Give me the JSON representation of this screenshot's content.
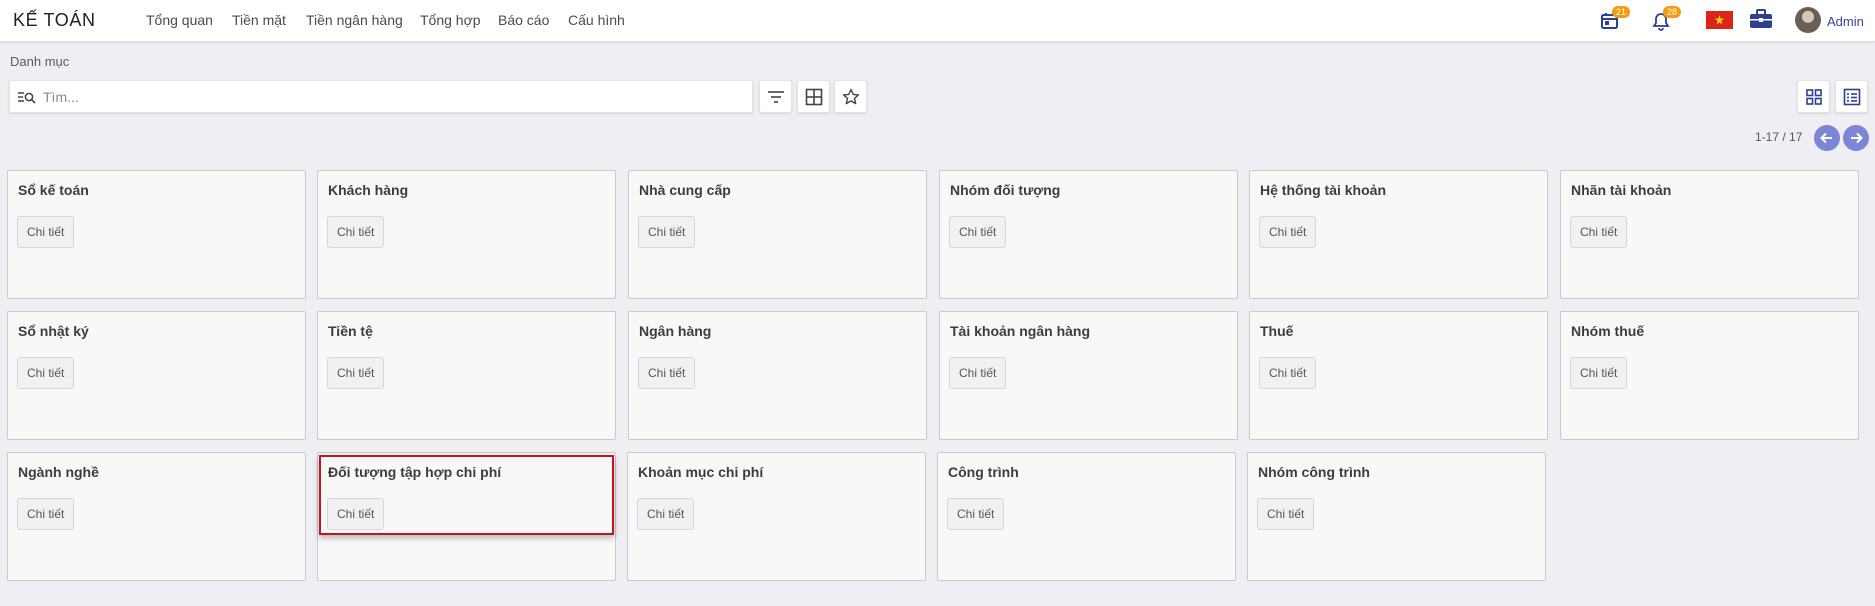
{
  "app": {
    "title": "KẾ TOÁN"
  },
  "menu": [
    {
      "label": "Tổng quan"
    },
    {
      "label": "Tiền mặt"
    },
    {
      "label": "Tiền ngân hàng"
    },
    {
      "label": "Tổng hợp"
    },
    {
      "label": "Báo cáo"
    },
    {
      "label": "Cấu hình"
    }
  ],
  "header": {
    "calendar_badge": "21",
    "notification_badge": "28",
    "user_name": "Admin"
  },
  "breadcrumb": "Danh mục",
  "search": {
    "placeholder": "Tìm..."
  },
  "pager": {
    "text": "1-17 / 17"
  },
  "card_button_label": "Chi tiết",
  "cards": [
    {
      "title": "Sổ kế toán",
      "button": "Chi tiết"
    },
    {
      "title": "Khách hàng",
      "button": "Chi tiết"
    },
    {
      "title": "Nhà cung cấp",
      "button": "Chi tiết"
    },
    {
      "title": "Nhóm đối tượng",
      "button": "Chi tiết"
    },
    {
      "title": "Hệ thống tài khoản",
      "button": "Chi tiết"
    },
    {
      "title": "Nhãn tài khoản",
      "button": "Chi tiết"
    },
    {
      "title": "Sổ nhật ký",
      "button": "Chi tiết"
    },
    {
      "title": "Tiền tệ",
      "button": "Chi tiết"
    },
    {
      "title": "Ngân hàng",
      "button": "Chi tiết"
    },
    {
      "title": "Tài khoản ngân hàng",
      "button": "Chi tiết"
    },
    {
      "title": "Thuế",
      "button": "Chi tiết"
    },
    {
      "title": "Nhóm thuế",
      "button": "Chi tiết"
    },
    {
      "title": "Ngành nghề",
      "button": "Chi tiết"
    },
    {
      "title": "Đối tượng tập hợp chi phí",
      "button": "Chi tiết"
    },
    {
      "title": "Khoản mục chi phí",
      "button": "Chi tiết"
    },
    {
      "title": "Công trình",
      "button": "Chi tiết"
    },
    {
      "title": "Nhóm công trình",
      "button": "Chi tiết"
    }
  ],
  "colors": {
    "accent": "#7c86d6",
    "badge": "#f39c12",
    "highlight": "#c0161f",
    "background": "#efeff3"
  },
  "icons": [
    "calendar-icon",
    "bell-icon",
    "vietnam-flag-icon",
    "briefcase-icon",
    "filter-icon",
    "group-by-icon",
    "favorite-star-icon",
    "kanban-view-icon",
    "list-view-icon",
    "search-icon",
    "arrow-left-icon",
    "arrow-right-icon"
  ]
}
